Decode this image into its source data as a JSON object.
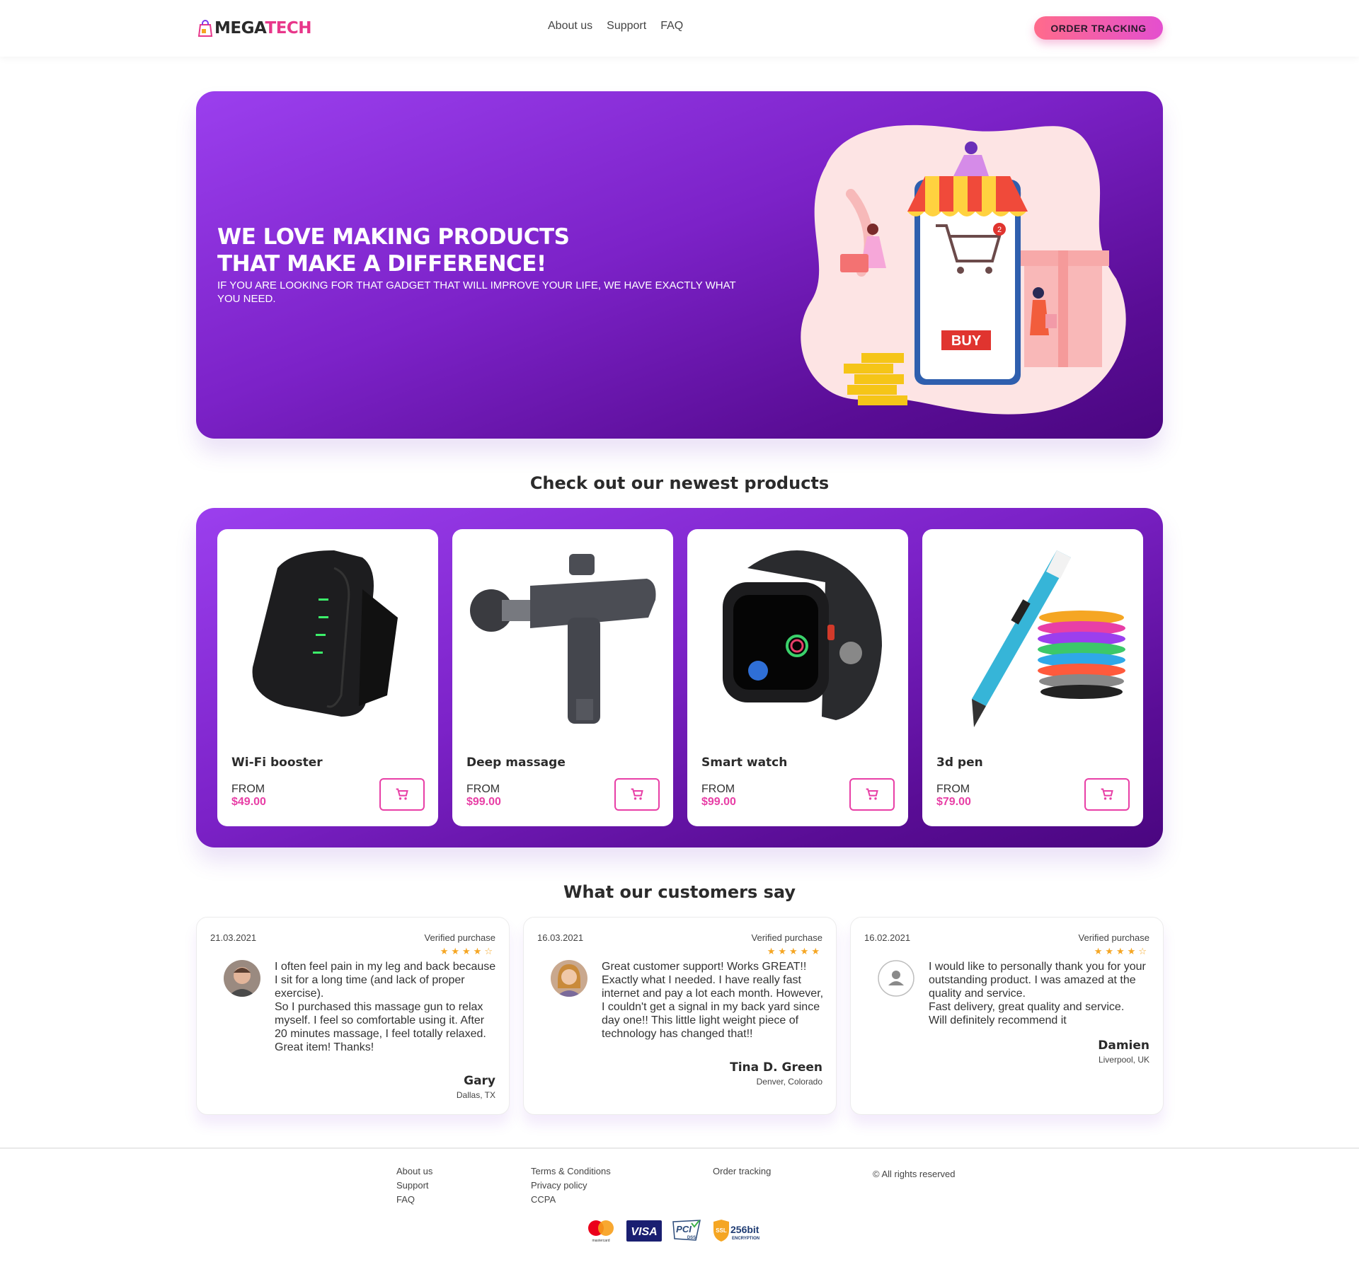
{
  "header": {
    "logo_mega": "MEGA",
    "logo_tech": "TECH",
    "nav": [
      "About us",
      "Support",
      "FAQ"
    ],
    "tracking_button": "ORDER TRACKING"
  },
  "hero": {
    "title": "WE LOVE MAKING PRODUCTS\nTHAT MAKE A DIFFERENCE!",
    "subtitle": "IF YOU ARE LOOKING FOR THAT GADGET THAT WILL IMPROVE YOUR LIFE, WE HAVE EXACTLY WHAT YOU NEED.",
    "illustration_label": "BUY",
    "cart_badge": "2"
  },
  "products_section": {
    "title": "Check out our newest products",
    "items": [
      {
        "name": "Wi-Fi booster",
        "from_label": "FROM",
        "price": "$49.00",
        "icon": "cart-icon"
      },
      {
        "name": "Deep massage",
        "from_label": "FROM",
        "price": "$99.00",
        "icon": "cart-icon"
      },
      {
        "name": "Smart watch",
        "from_label": "FROM",
        "price": "$99.00",
        "icon": "cart-icon"
      },
      {
        "name": "3d pen",
        "from_label": "FROM",
        "price": "$79.00",
        "icon": "cart-icon"
      }
    ]
  },
  "reviews_section": {
    "title": "What our customers say",
    "reviews": [
      {
        "date": "21.03.2021",
        "verified": "Verified purchase",
        "stars": "★★★★☆",
        "rating": 4.5,
        "text": "I often feel pain in my leg and back because I sit for a long time (and lack of proper exercise).\nSo I purchased this massage gun to relax myself. I feel so comfortable using it. After 20 minutes massage, I feel totally relaxed.\nGreat item! Thanks!",
        "name": "Gary",
        "location": "Dallas, TX"
      },
      {
        "date": "16.03.2021",
        "verified": "Verified purchase",
        "stars": "★★★★★",
        "rating": 5,
        "text": "Great customer support! Works GREAT!! Exactly what I needed. I have really fast internet and pay a lot each month. However, I couldn't get a signal in my back yard since day one!! This little light weight piece of technology has changed that!!",
        "name": "Tina D. Green",
        "location": "Denver, Colorado"
      },
      {
        "date": "16.02.2021",
        "verified": "Verified purchase",
        "stars": "★★★★☆",
        "rating": 4,
        "text": "I would like to personally thank you for your outstanding product. I was amazed at the quality and service.\nFast delivery, great quality and service.\nWill definitely recommend it",
        "name": "Damien",
        "location": "Liverpool, UK"
      }
    ]
  },
  "footer": {
    "col1": [
      "About us",
      "Support",
      "FAQ"
    ],
    "col2": [
      "Terms & Conditions",
      "Privacy policy",
      "CCPA"
    ],
    "col3": [
      "Order tracking"
    ],
    "copyright": "© All rights reserved",
    "payments": {
      "mastercard": "mastercard",
      "visa": "VISA",
      "pci": "PCI",
      "pci_dss": "DSS",
      "ssl": "SSL",
      "ssl_bits": "256bit",
      "ssl_enc": "ENCRYPTION"
    }
  },
  "colors": {
    "accent_pink": "#e83fa6",
    "hero_purple": "#7c22c8",
    "star": "#f5a623"
  }
}
